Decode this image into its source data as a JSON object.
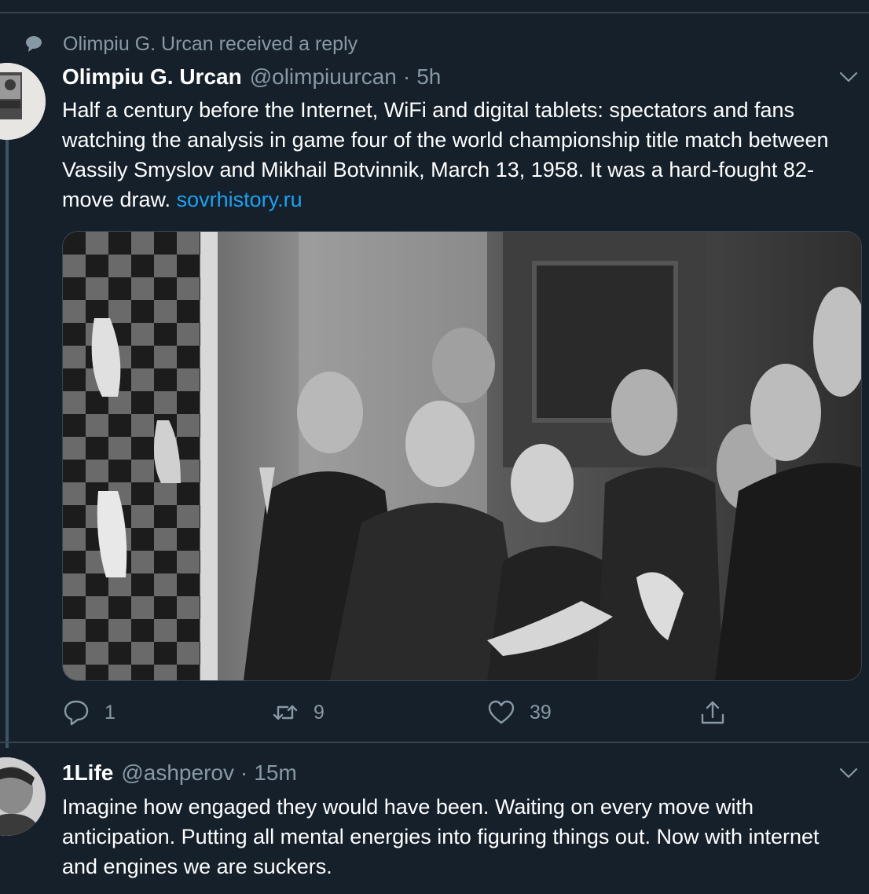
{
  "context": {
    "text": "Olimpiu G. Urcan received a reply"
  },
  "tweets": [
    {
      "name": "Olimpiu G. Urcan",
      "handle": "@olimpiuurcan",
      "dot": "·",
      "time": "5h",
      "text": "Half a century before the Internet, WiFi and digital tablets: spectators and fans watching the analysis in game four of the world championship title match between Vassily Smyslov and Mikhail Botvinnik, March 13, 1958. It was a hard-fought 82-move draw. ",
      "link": "sovrhistory.ru",
      "actions": {
        "reply": "1",
        "retweet": "9",
        "like": "39"
      }
    },
    {
      "name": "1Life",
      "handle": "@ashperov",
      "dot": "·",
      "time": "15m",
      "text": "Imagine how engaged they would have been. Waiting on every move with anticipation. Putting all mental energies into figuring things out. Now with internet and engines we are suckers."
    }
  ],
  "icons": {
    "context": "speech-bubble-icon",
    "reply": "reply-icon",
    "retweet": "retweet-icon",
    "like": "heart-icon",
    "share": "share-icon",
    "menu": "chevron-down-icon"
  },
  "colors": {
    "background": "#15202b",
    "secondary_text": "#8899a6",
    "link": "#1da1f2",
    "border": "#38444d"
  }
}
